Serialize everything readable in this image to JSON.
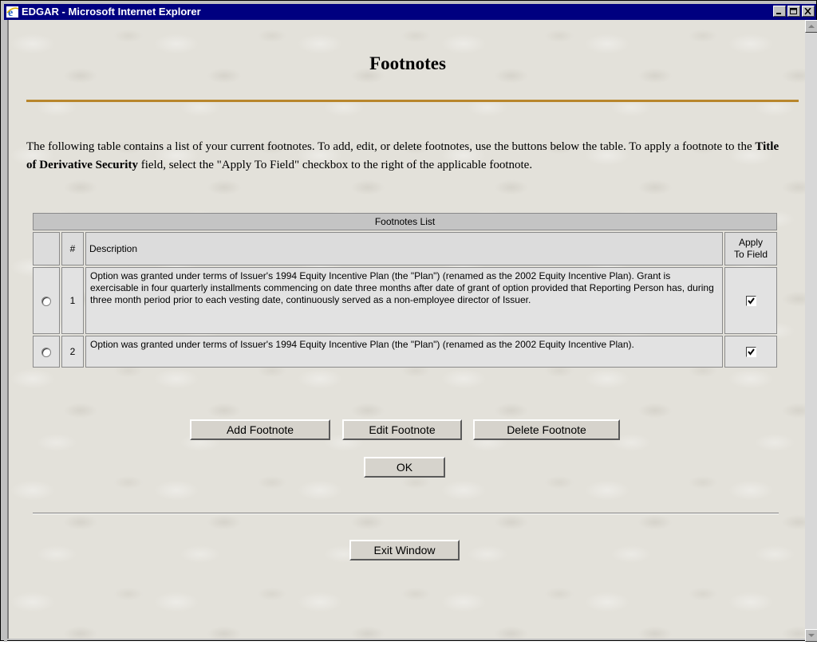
{
  "window": {
    "title": "EDGAR - Microsoft Internet Explorer"
  },
  "page": {
    "heading": "Footnotes",
    "intro_part1": "The following table contains a list of your current footnotes. To add, edit, or delete footnotes, use the buttons below the table. To apply a footnote to the ",
    "intro_bold": "Title of Derivative Security",
    "intro_part2": " field, select the \"Apply To Field\" checkbox to the right of the applicable footnote."
  },
  "table": {
    "caption": "Footnotes List",
    "headers": {
      "num": "#",
      "description": "Description",
      "apply_line1": "Apply",
      "apply_line2": "To Field"
    },
    "rows": [
      {
        "num": "1",
        "description": "Option was granted under terms of Issuer's 1994 Equity Incentive Plan (the \"Plan\") (renamed as the 2002 Equity Incentive Plan). Grant is exercisable in four quarterly installments commencing on date three months after date of grant of option provided that Reporting Person has, during three month period prior to each vesting date, continuously served as a non-employee director of Issuer.",
        "selected": false,
        "apply": true
      },
      {
        "num": "2",
        "description": "Option was granted under terms of Issuer's 1994 Equity Incentive Plan (the \"Plan\") (renamed as the 2002 Equity Incentive Plan).",
        "selected": false,
        "apply": true
      }
    ]
  },
  "buttons": {
    "add": "Add Footnote",
    "edit": "Edit Footnote",
    "delete": "Delete Footnote",
    "ok": "OK",
    "exit": "Exit Window"
  },
  "colors": {
    "titlebar": "#000080",
    "accent_rule": "#b8862c",
    "page_bg": "#e3e1da"
  }
}
